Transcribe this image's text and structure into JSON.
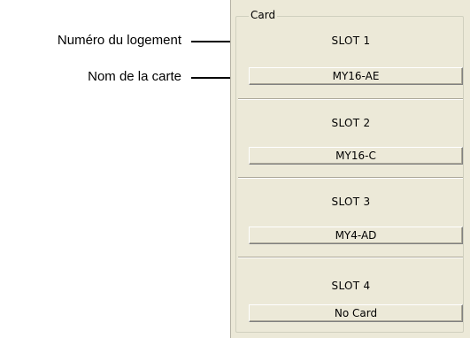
{
  "callouts": {
    "slot_number": "Numéro du logement",
    "card_name": "Nom de la carte"
  },
  "panel": {
    "group_label": "Card",
    "slots": [
      {
        "title": "SLOT 1",
        "card": "MY16-AE"
      },
      {
        "title": "SLOT 2",
        "card": "MY16-C"
      },
      {
        "title": "SLOT 3",
        "card": "MY4-AD"
      },
      {
        "title": "SLOT 4",
        "card": "No Card"
      }
    ]
  }
}
